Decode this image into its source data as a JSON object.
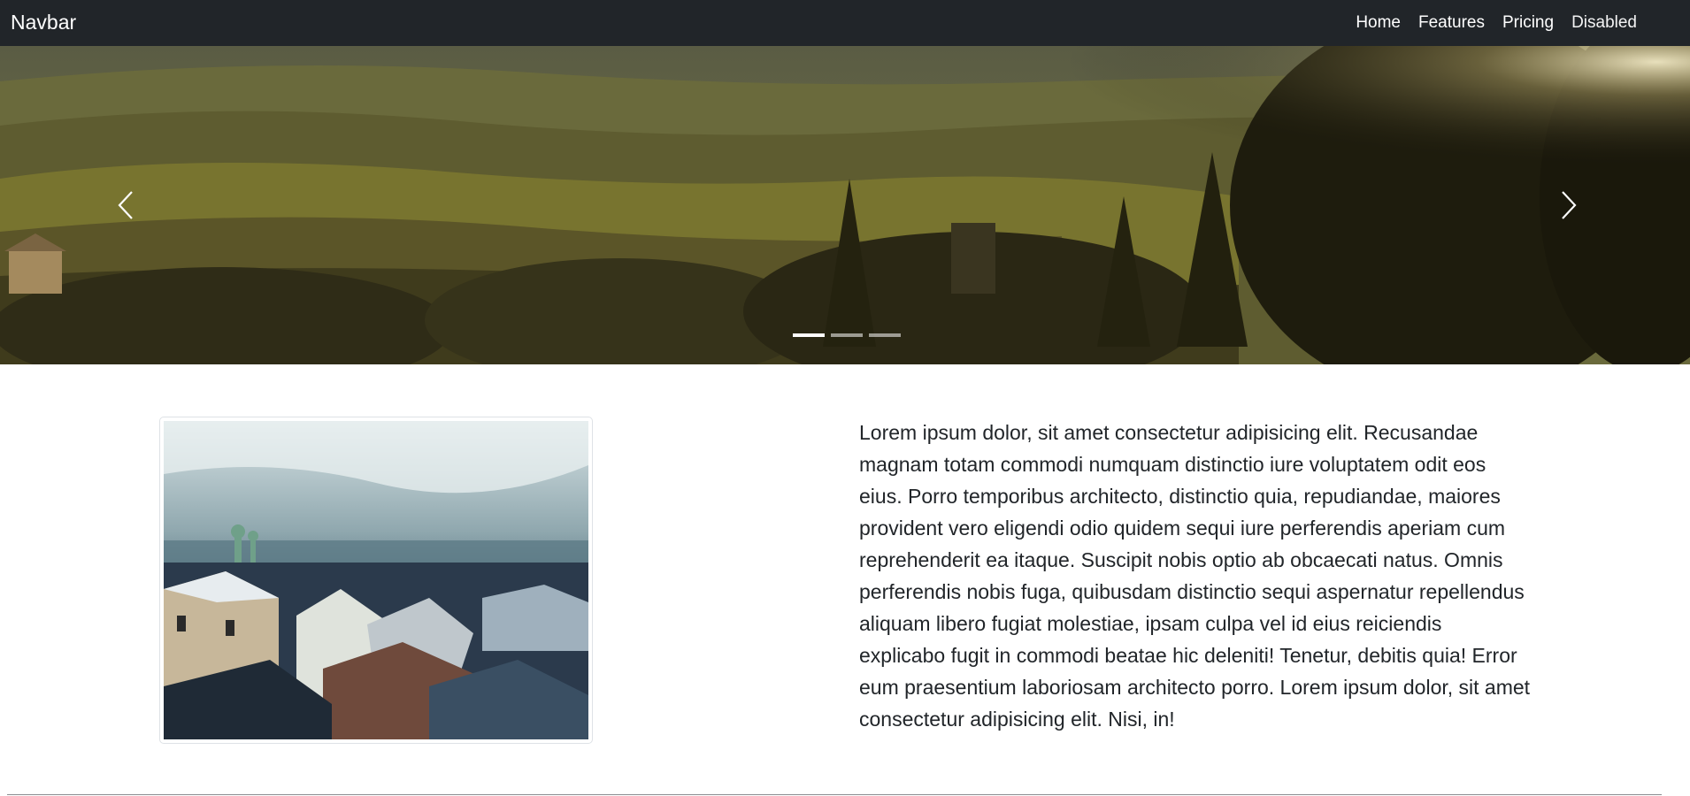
{
  "navbar": {
    "brand": "Navbar",
    "links": [
      {
        "label": "Home"
      },
      {
        "label": "Features"
      },
      {
        "label": "Pricing"
      },
      {
        "label": "Disabled"
      }
    ]
  },
  "carousel": {
    "prev_icon": "chevron-left-icon",
    "next_icon": "chevron-right-icon",
    "indicator_count": 3,
    "active_index": 0
  },
  "content": {
    "paragraph": "Lorem ipsum dolor, sit amet consectetur adipisicing elit. Recusandae magnam totam commodi numquam distinctio iure voluptatem odit eos eius. Porro temporibus architecto, distinctio quia, repudiandae, maiores provident vero eligendi odio quidem sequi iure perferendis aperiam cum reprehenderit ea itaque. Suscipit nobis optio ab obcaecati natus. Omnis perferendis nobis fuga, quibusdam distinctio sequi aspernatur repellendus aliquam libero fugiat molestiae, ipsam culpa vel id eius reiciendis explicabo fugit in commodi beatae hic deleniti! Tenetur, debitis quia! Error eum praesentium laboriosam architecto porro. Lorem ipsum dolor, sit amet consectetur adipisicing elit. Nisi, in!"
  },
  "colors": {
    "navbar_bg": "#212529",
    "nav_text": "#ffffff",
    "body_text": "#212529"
  }
}
